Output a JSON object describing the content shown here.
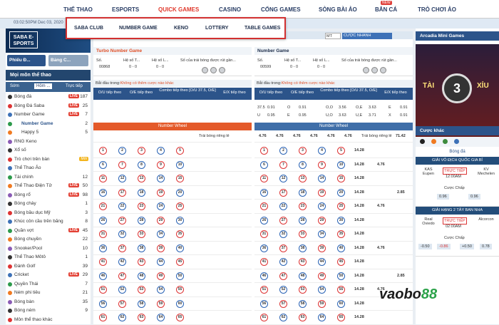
{
  "topnav": {
    "items": [
      "THỂ THAO",
      "ESPORTS",
      "QUICK GAMES",
      "CASINO",
      "CỔNG GAMES",
      "SÒNG BÀI ẢO",
      "BẮN CÁ",
      "TRÒ CHƠI ẢO"
    ],
    "badge_new": "NEW"
  },
  "clock": "03:02:50PM Dec 03, 2020",
  "quick_menu": [
    "SABA CLUB",
    "NUMBER GAME",
    "KENO",
    "LOTTERY",
    "TABLE GAMES"
  ],
  "left": {
    "banner_logo": "SABA E-SPORTS",
    "btn_bet": "Phiếu Đ...",
    "btn_table": "Bảng C...",
    "head": "Mọi môn thể thao",
    "tabs": [
      "Sớm",
      "Hôm ...",
      "Trực tiếp"
    ],
    "sports": [
      {
        "name": "Bóng đá",
        "count": "187",
        "live": true
      },
      {
        "name": "Bóng Đá Saba",
        "count": "25",
        "live": true
      },
      {
        "name": "Number Game",
        "count": "7",
        "live": true
      },
      {
        "name": "Number Game",
        "count": "2",
        "live": false
      },
      {
        "name": "Happy 5",
        "count": "5",
        "live": false
      },
      {
        "name": "RNG Keno",
        "count": "",
        "live": false
      },
      {
        "name": "Xổ số",
        "count": "",
        "live": false
      },
      {
        "name": "Trò chơi trên bàn",
        "count": "",
        "live": false,
        "more": "Mới"
      },
      {
        "name": "Thể Thao Ảo",
        "count": "",
        "live": false
      },
      {
        "name": "Tài chính",
        "count": "12",
        "live": false
      },
      {
        "name": "Thể Thao Điện Tử",
        "count": "50",
        "live": true
      },
      {
        "name": "Bóng rổ",
        "count": "98",
        "live": true
      },
      {
        "name": "Bóng chày",
        "count": "1",
        "live": false
      },
      {
        "name": "Bóng bầu dục Mỹ",
        "count": "3",
        "live": false
      },
      {
        "name": "Khúc côn cầu trên băng",
        "count": "8",
        "live": false
      },
      {
        "name": "Quần vợt",
        "count": "45",
        "live": true
      },
      {
        "name": "Bóng chuyền",
        "count": "22",
        "live": false
      },
      {
        "name": "Snooker/Pool",
        "count": "10",
        "live": false
      },
      {
        "name": "Thể Thao Môtô",
        "count": "1",
        "live": false
      },
      {
        "name": "Đánh Golf",
        "count": "39",
        "live": false
      },
      {
        "name": "Cricket",
        "count": "29",
        "live": true
      },
      {
        "name": "Quyền Thái",
        "count": "7",
        "live": false
      },
      {
        "name": "Ném phi tiêu",
        "count": "21",
        "live": false
      },
      {
        "name": "Bóng bàn",
        "count": "35",
        "live": false
      },
      {
        "name": "Bóng ném",
        "count": "9",
        "live": false
      },
      {
        "name": "Môn thể thao khác",
        "count": "",
        "live": false
      }
    ]
  },
  "center": {
    "mt": "MT",
    "fast_bet": "CƯỢC NHANH",
    "left_panel": {
      "title": "Turbo Number Game",
      "so_label": "Số.",
      "so_val": "00868",
      "hs1_label": "Hệ số T...",
      "hs1_val": "0 - 0",
      "hs2_label": "Hệ số L...",
      "hs2_val": "0 - 0",
      "drawn_label": "Số của trái bóng được rút gần...",
      "start": "Bắt đầu trong:",
      "start_note": "Không có thêm cược nào khác",
      "cols": [
        "O/U tiếp theo",
        "O/E tiếp theo",
        "Combo tiếp theo [O/U 37.5, O/E]",
        "E/X tiếp theo"
      ],
      "wheel": "Number Wheel",
      "single": "Trái bóng riêng lẻ"
    },
    "right_panel": {
      "title": "Number Game",
      "so_label": "Số.",
      "so_val": "00599",
      "hs1_label": "Hệ số T...",
      "hs1_val": "0 - 0",
      "hs2_label": "Hệ số L...",
      "hs2_val": "0 - 0",
      "drawn_label": "Số của trái bóng được rút gần...",
      "start": "Bắt đầu trong:",
      "start_note": "Không có thêm cược nào khác",
      "cols": [
        "O/U tiếp theo",
        "O/E tiếp theo",
        "Combo tiếp theo [O/U 37.5, O/E]",
        "E/X tiếp theo"
      ],
      "odds": [
        [
          "37.5",
          "0.91",
          "O",
          "0.91",
          "O,O",
          "3.56",
          "O,E",
          "3.63",
          "E",
          "0.91"
        ],
        [
          "U",
          "0.95",
          "E",
          "0.95",
          "U,O",
          "3.63",
          "U,E",
          "3.71",
          "X",
          "0.91"
        ]
      ],
      "wheel": "Number Wheel",
      "wheel_odds": [
        "4.76",
        "4.76",
        "4.76",
        "4.76",
        "4.76",
        "4.76"
      ],
      "single": "Trái bóng riêng lẻ",
      "single_odds": "71.42",
      "row_odds": [
        "14.28",
        "4.76",
        "2.85"
      ]
    }
  },
  "right": {
    "mini_head": "Arcadia Mini Games",
    "game_center": "3",
    "game_tai": "TÀI",
    "game_xiu": "XỈU",
    "other_head": "Cược khác",
    "sport": "Bóng đá",
    "m1": {
      "league": "GIẢI VÔ ĐỊCH QUỐC GIA BỈ",
      "home": "KAS Eupen",
      "away": "KV Mechelen",
      "status": "TRỰC TIẾP",
      "time": "12:00AM",
      "market": "Cược Chấp",
      "o1": "0.96",
      "o2": "0.96"
    },
    "m2": {
      "league": "GIẢI HẠNG 2 TÂY BAN NHA",
      "home": "Real Oviedo",
      "away": "Alcorcon",
      "status": "TRỰC TIẾP",
      "time": "02:00AM",
      "market": "Cược Chấp",
      "o1": "-0.50",
      "o2": "-0.86",
      "o3": "+0.50",
      "o4": "0.78"
    }
  },
  "watermark": {
    "a": "vaobo",
    "b": "88"
  }
}
